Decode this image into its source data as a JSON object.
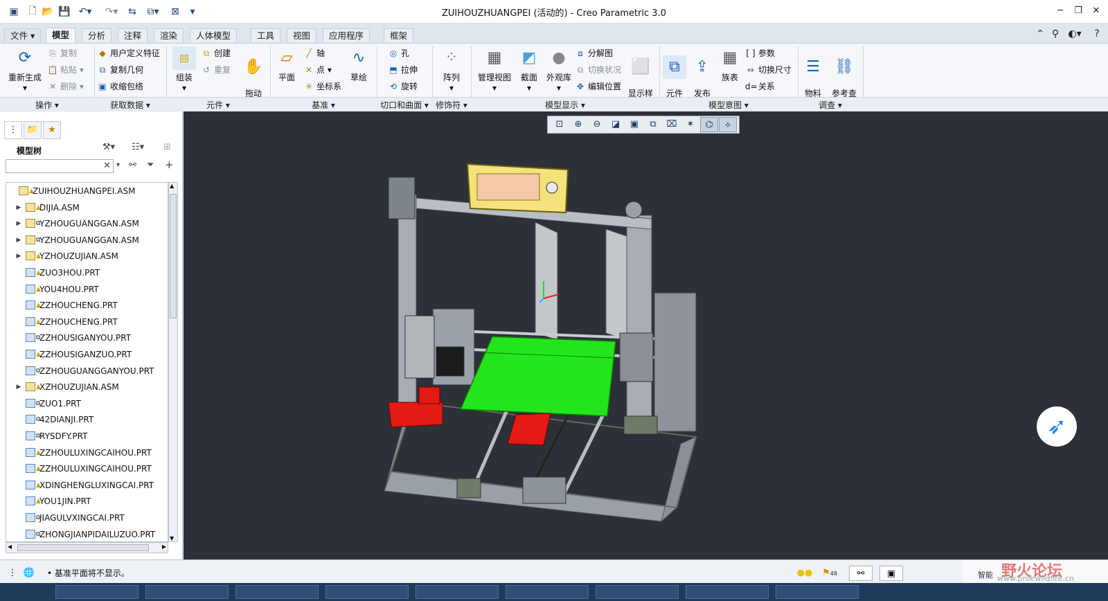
{
  "titlebar": {
    "title": "ZUIHOUZHUANGPEI (活动的) - Creo Parametric 3.0",
    "quick_access_icons": [
      "app-icon",
      "new-icon",
      "open-icon",
      "save-icon",
      "undo-icon",
      "redo-icon",
      "regenerate-icon",
      "switch-window-icon",
      "close-window-icon",
      "customize-icon"
    ],
    "window_buttons": {
      "minimize": "─",
      "restore": "❐",
      "close": "✕"
    }
  },
  "tabs": [
    "文件",
    "模型",
    "分析",
    "注释",
    "渲染",
    "人体模型",
    "工具",
    "视图",
    "应用程序",
    "框架"
  ],
  "active_tab": "模型",
  "ribbon": {
    "operations": {
      "regen": "重新生成",
      "copy": "复制",
      "paste": "粘贴",
      "delete": "删除"
    },
    "get_data": {
      "udf": "用户定义特征",
      "copy_geom": "复制几何",
      "shrinkwrap": "收缩包络"
    },
    "components": {
      "assemble": "组装",
      "create": "创建",
      "repeat": "重复"
    },
    "drag": "拖动\n元件",
    "datum": {
      "plane": "平面",
      "axis": "轴",
      "point": "点",
      "csys": "坐标系",
      "sketch": "草绘"
    },
    "cut_surface": {
      "hole": "孔",
      "extrude": "拉伸",
      "revolve": "旋转"
    },
    "modifiers": {
      "pattern": "阵列"
    },
    "model_display": {
      "manage_views": "管理视图",
      "section": "截面",
      "appearance": "外观库",
      "explode": "分解图",
      "toggle_state": "切换状况",
      "edit_position": "编辑位置",
      "display_style": "显示样\n式"
    },
    "model_intent": {
      "comp_interface": "元件\n界面",
      "publish_geom": "发布\n几何",
      "family_table": "族表",
      "params": "参数",
      "switch_dims": "切换尺寸",
      "relations": "关系"
    },
    "investigate": {
      "bom": "物料\n清单",
      "ref_viewer": "参考查\n看器"
    }
  },
  "groups": [
    "操作",
    "获取数据",
    "元件",
    "基准",
    "切口和曲面",
    "修饰符",
    "模型显示",
    "模型意图",
    "调查"
  ],
  "left_panel": {
    "title": "模型树",
    "search_value": "",
    "tree": [
      {
        "name": "ZUIHOUZHUANGPEI.ASM",
        "type": "asm",
        "level": 0,
        "expand": false,
        "mark": "warn"
      },
      {
        "name": "DIJIA.ASM",
        "type": "asm",
        "level": 1,
        "expand": true,
        "mark": "warn"
      },
      {
        "name": "YZHOUGUANGGAN.ASM",
        "type": "asm",
        "level": 1,
        "expand": true,
        "mark": "link"
      },
      {
        "name": "YZHOUGUANGGAN.ASM",
        "type": "asm",
        "level": 1,
        "expand": true,
        "mark": "link"
      },
      {
        "name": "YZHOUZUJIAN.ASM",
        "type": "asm",
        "level": 1,
        "expand": true,
        "mark": "warn"
      },
      {
        "name": "ZUO3HOU.PRT",
        "type": "prt",
        "level": 1,
        "expand": false,
        "mark": "warn"
      },
      {
        "name": "YOU4HOU.PRT",
        "type": "prt",
        "level": 1,
        "expand": false,
        "mark": "warn"
      },
      {
        "name": "ZZHOUCHENG.PRT",
        "type": "prt",
        "level": 1,
        "expand": false,
        "mark": "warn"
      },
      {
        "name": "ZZHOUCHENG.PRT",
        "type": "prt",
        "level": 1,
        "expand": false,
        "mark": "warn"
      },
      {
        "name": "ZZHOUSIGANYOU.PRT",
        "type": "prt",
        "level": 1,
        "expand": false,
        "mark": "link"
      },
      {
        "name": "ZZHOUSIGANZUO.PRT",
        "type": "prt",
        "level": 1,
        "expand": false,
        "mark": "warn"
      },
      {
        "name": "ZZHOUGUANGGANYOU.PRT",
        "type": "prt",
        "level": 1,
        "expand": false,
        "mark": "link"
      },
      {
        "name": "XZHOUZUJIAN.ASM",
        "type": "asm",
        "level": 1,
        "expand": true,
        "mark": "warn"
      },
      {
        "name": "ZUO1.PRT",
        "type": "prt",
        "level": 1,
        "expand": false,
        "mark": "link"
      },
      {
        "name": "42DIANJI.PRT",
        "type": "prt",
        "level": 1,
        "expand": false,
        "mark": "link"
      },
      {
        "name": "RYSDFY.PRT",
        "type": "prt",
        "level": 1,
        "expand": false,
        "mark": "link"
      },
      {
        "name": "ZZHOULUXINGCAIHOU.PRT",
        "type": "prt",
        "level": 1,
        "expand": false,
        "mark": "warn"
      },
      {
        "name": "ZZHOULUXINGCAIHOU.PRT",
        "type": "prt",
        "level": 1,
        "expand": false,
        "mark": "warn"
      },
      {
        "name": "XDINGHENGLUXINGCAI.PRT",
        "type": "prt",
        "level": 1,
        "expand": false,
        "mark": "warn"
      },
      {
        "name": "YOU1JIN.PRT",
        "type": "prt",
        "level": 1,
        "expand": false,
        "mark": "warn"
      },
      {
        "name": "JIAGULVXINGCAI.PRT",
        "type": "prt",
        "level": 1,
        "expand": false,
        "mark": "link"
      },
      {
        "name": "ZHONGJIANPIDAILUZUO.PRT",
        "type": "prt",
        "level": 1,
        "expand": false,
        "mark": "link"
      }
    ]
  },
  "status": {
    "message": "基准平面将不显示。",
    "flag_count": "48"
  },
  "watermark": {
    "title": "野火论坛",
    "url": "www.proewildfire.cn",
    "smart": "智能"
  },
  "colors": {
    "viewport_bg": "#2c3137",
    "bed": "#22e61b",
    "red_parts": "#e31b14",
    "lcd": "#f4e27a"
  }
}
